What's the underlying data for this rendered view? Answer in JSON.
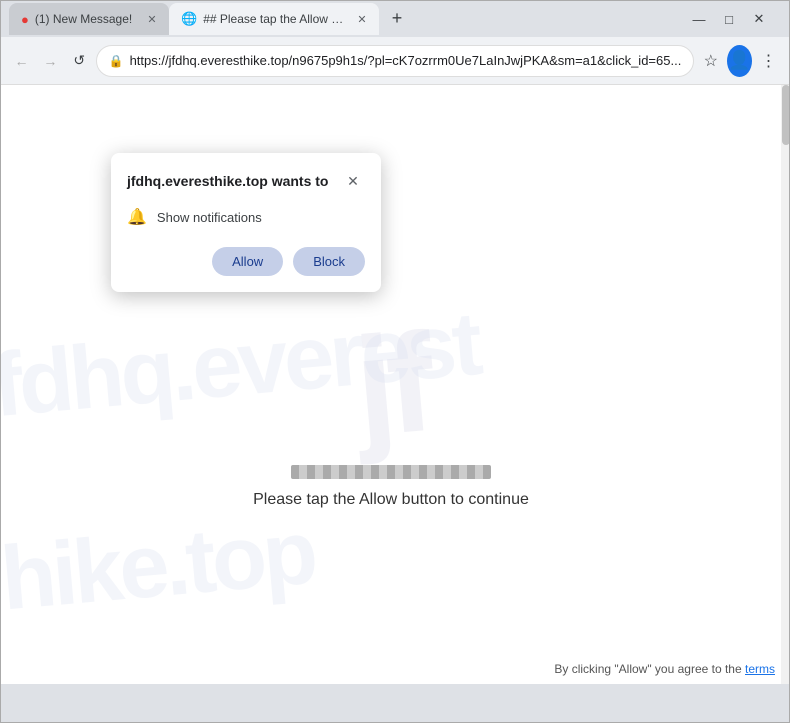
{
  "browser": {
    "title_bar": {
      "minimize": "—",
      "maximize": "□",
      "close": "✕"
    },
    "tabs": [
      {
        "id": "tab-1",
        "favicon": "●",
        "favicon_color": "#e53935",
        "title": "(1) New Message!",
        "active": false,
        "close": "✕"
      },
      {
        "id": "tab-2",
        "favicon": "🔵",
        "title": "## Please tap the Allow button",
        "active": true,
        "close": "✕"
      }
    ],
    "new_tab_label": "+",
    "nav": {
      "back": "←",
      "forward": "→",
      "reload": "↺",
      "url": "https://jfdhq.everesthike.top/n9675p9h1s/?pl=cK7ozrrm0Ue7LaInJwjPKA&sm=a1&click_id=65...",
      "star": "☆",
      "profile": "👤",
      "menu": "⋮"
    },
    "scrollbar": {
      "visible": true
    }
  },
  "permission_dialog": {
    "title": "jfdhq.everesthike.top wants to",
    "close_icon": "✕",
    "permission_text": "Show notifications",
    "allow_label": "Allow",
    "block_label": "Block"
  },
  "page": {
    "instruction_text": "Please tap the Allow button to continue",
    "footer_text": "By clicking \"Allow\" you agree to the",
    "footer_link": "terms"
  }
}
